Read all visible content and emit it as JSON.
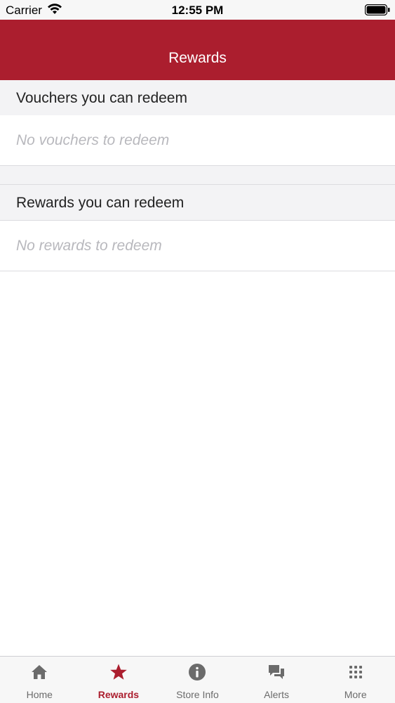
{
  "status_bar": {
    "carrier": "Carrier",
    "time": "12:55 PM"
  },
  "nav": {
    "title": "Rewards"
  },
  "sections": [
    {
      "header": "Vouchers you can redeem",
      "empty_text": "No vouchers to redeem"
    },
    {
      "header": "Rewards you can redeem",
      "empty_text": "No rewards to redeem"
    }
  ],
  "tabs": [
    {
      "label": "Home",
      "icon": "home-icon",
      "active": false
    },
    {
      "label": "Rewards",
      "icon": "star-icon",
      "active": true
    },
    {
      "label": "Store Info",
      "icon": "info-icon",
      "active": false
    },
    {
      "label": "Alerts",
      "icon": "chat-bubbles-icon",
      "active": false
    },
    {
      "label": "More",
      "icon": "grid-dots-icon",
      "active": false
    }
  ],
  "colors": {
    "brand": "#ab1e2e",
    "tab_inactive": "#6b6b6b",
    "placeholder_text": "#b8b8bd"
  }
}
